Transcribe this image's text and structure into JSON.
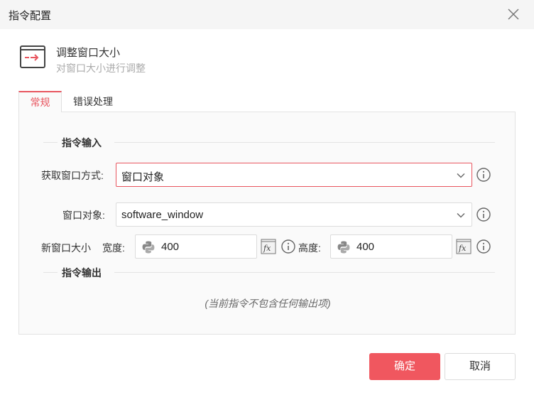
{
  "dialog": {
    "title": "指令配置"
  },
  "command": {
    "name": "调整窗口大小",
    "description": "对窗口大小进行调整"
  },
  "tabs": [
    {
      "label": "常规",
      "active": true
    },
    {
      "label": "错误处理",
      "active": false
    }
  ],
  "input_section": {
    "title": "指令输入",
    "fields": {
      "method": {
        "label": "获取窗口方式:",
        "value": "窗口对象"
      },
      "window_object": {
        "label": "窗口对象:",
        "value": "software_window"
      },
      "size": {
        "label": "新窗口大小",
        "width_label": "宽度:",
        "width_value": "400",
        "height_label": "高度:",
        "height_value": "400"
      }
    }
  },
  "output_section": {
    "title": "指令输出",
    "empty_message": "(当前指令不包含任何输出项)"
  },
  "buttons": {
    "ok": "确定",
    "cancel": "取消"
  },
  "colors": {
    "accent": "#f0575f",
    "tab_active": "#e8555f",
    "panel_bg": "#fafafa",
    "titlebar_bg": "#f5f5f5"
  },
  "icons": [
    "close-icon",
    "window-resize-icon",
    "chevron-down-icon",
    "info-icon",
    "python-icon",
    "fx-icon"
  ]
}
